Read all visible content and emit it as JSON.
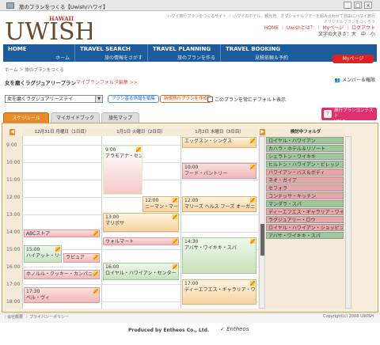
{
  "window": {
    "title": "旅のプランをつくる【Uwish/ハワイ】"
  },
  "header": {
    "brand_top": "HAWAII",
    "brand_main": "UWISH",
    "top_links": "ハワイ旅行プランをつくるサイト ｜ ハワイのホテル、観光地、オプショナルツアーを組み合わせて自由にハワイ旅行",
    "sub_desc": "オリジナルプランをつくろう",
    "user_links": "HOME ｜ Uwishとは？ ｜ Myページ ｜ ログアウト",
    "font_size": "文字の大きさ：大　中　小"
  },
  "nav": [
    {
      "en": "HOME",
      "jp": "ホーム"
    },
    {
      "en": "TRAVEL SEARCH",
      "jp": "旅の情報をさがす"
    },
    {
      "en": "TRAVEL PLANNING",
      "jp": "旅のプランを作る"
    },
    {
      "en": "TRAVEL BOOKING",
      "jp": "見積依頼＆予約"
    }
  ],
  "mypage_btn": "Myページ",
  "breadcrumb": "ホーム ＞ 旅のプランをつくる",
  "plan": {
    "title": "女を磨くラグジュアリープラン",
    "folder_link": "マイプランフォルダ編集 >>",
    "member": "メンバー＆権限",
    "select_value": "女を磨くラグジュアリーステイ",
    "btn_edit": "プラン基本情報を編集",
    "btn_new": "新規旅行プランを作成",
    "default_label": "このプランを常にデフォルト表示"
  },
  "contest": {
    "line1": "旅行プランコンテスト",
    "line2": "HELP"
  },
  "tabs": [
    "スケジュール",
    "マイガイドブック",
    "旅先マップ"
  ],
  "days": [
    "12月31日 月曜日（1日目）",
    "1月1日 火曜日（2日目）",
    "1月2日 水曜日（3日目）"
  ],
  "folder_title": "検討中フォルダ",
  "times": [
    "9:00",
    "10:00",
    "11:00",
    "12:00",
    "13:00",
    "14:00",
    "15:00",
    "16:00",
    "17:00",
    "18:00"
  ],
  "events": {
    "d1": [
      {
        "time": "",
        "label": "ABCストア",
        "c": "pinkb"
      },
      {
        "time": "15:00",
        "label": "ハイアット・リージェンシー",
        "c": "green"
      },
      {
        "time": "",
        "label": "ラピュア",
        "c": "pinkb"
      },
      {
        "time": "",
        "label": "ホノルル・クッキー・カンパニー",
        "c": "pinkb"
      },
      {
        "time": "17:30",
        "label": "ベル・ヴィ",
        "c": "pinkb"
      }
    ],
    "d2": [
      {
        "time": "9:00",
        "label": "アラモアナ・センター",
        "c": "pink"
      },
      {
        "time": "12:00",
        "label": "ニーマン・マーカス",
        "c": "orange"
      },
      {
        "time": "13:00",
        "label": "マリポサ",
        "c": "orange"
      },
      {
        "time": "",
        "label": "ウォルマート",
        "c": "pinkb"
      },
      {
        "time": "16:00",
        "label": "ロイヤル・ハワイアン・センター",
        "c": "green"
      }
    ],
    "d3": [
      {
        "time": "",
        "label": "エッグスン・シングス",
        "c": "orange"
      },
      {
        "time": "10:00",
        "label": "フード・パントリー",
        "c": "pinkb"
      },
      {
        "time": "12:00",
        "label": "マリーズ ヘルス フーズ オーガニック",
        "c": "orange"
      },
      {
        "time": "14:30",
        "label": "アバサ・ワイキキ・スパ",
        "c": "green"
      },
      {
        "time": "17:00",
        "label": "ディーエフエス・ギャラリア・ワイキキ",
        "c": "orange"
      }
    ]
  },
  "folder": [
    {
      "label": "ロイヤル・ハワイアン",
      "c": "fgreen"
    },
    {
      "label": "カハラ・ホテル＆リゾート",
      "c": "fgreen"
    },
    {
      "label": "シェラトン・ワイキキ",
      "c": "fgreen"
    },
    {
      "label": "ヒルトン・ハワイアン・ビレッジ",
      "c": "fgreen"
    },
    {
      "label": "ハワイアン・バス＆ボディ",
      "c": "fpink"
    },
    {
      "label": "ネオ・ガイア",
      "c": "fpink"
    },
    {
      "label": "セフォラ",
      "c": "fpink"
    },
    {
      "label": "コンテッサ・キッチン",
      "c": "fpink"
    },
    {
      "label": "マンダラ・スパ",
      "c": "fgreen"
    },
    {
      "label": "ディーエフエス・ギャラリア・ワイキ",
      "c": "fpink"
    },
    {
      "label": "ラグジュアリー・ロウ",
      "c": "fpink"
    },
    {
      "label": "ロイヤル・ハワイアン・ショッピング",
      "c": "fpink"
    },
    {
      "label": "アバサ・ワイキキ・スパ",
      "c": "fgreen"
    }
  ],
  "footer": {
    "links": "｜会社概要 ｜ プライバシーポリシー",
    "copy": "Copyright(c) 2008 UWISH",
    "producer": "Produced by Entheos Co., Ltd.",
    "entheos": "Entheos"
  }
}
